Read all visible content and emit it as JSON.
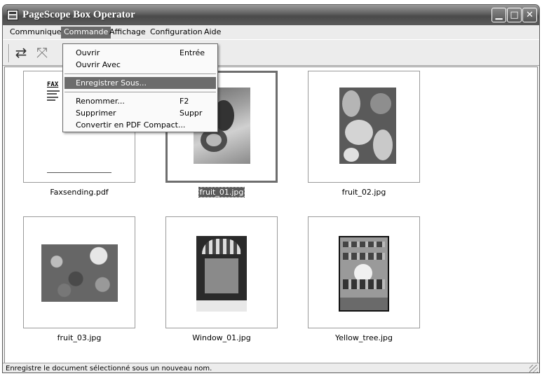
{
  "window": {
    "title": "PageScope Box Operator"
  },
  "menubar": {
    "items": [
      "Communiquer",
      "Commande",
      "Affichage",
      "Configuration",
      "Aide"
    ]
  },
  "dropdown": {
    "items": [
      {
        "label": "Ouvrir",
        "shortcut": "Entrée"
      },
      {
        "label": "Ouvrir Avec",
        "shortcut": ""
      },
      {
        "label": "Enregistrer Sous...",
        "shortcut": ""
      },
      {
        "label": "Renommer...",
        "shortcut": "F2"
      },
      {
        "label": "Supprimer",
        "shortcut": "Suppr"
      },
      {
        "label": "Convertir en PDF Compact...",
        "shortcut": ""
      }
    ]
  },
  "fax_doc": {
    "header": "FAX"
  },
  "files": [
    {
      "name": "Faxsending.pdf"
    },
    {
      "name": "fruit_01.jpg"
    },
    {
      "name": "fruit_02.jpg"
    },
    {
      "name": "fruit_03.jpg"
    },
    {
      "name": "Window_01.jpg"
    },
    {
      "name": "Yellow_tree.jpg"
    }
  ],
  "statusbar": {
    "text": "Enregistre le document sélectionné sous un nouveau nom."
  }
}
